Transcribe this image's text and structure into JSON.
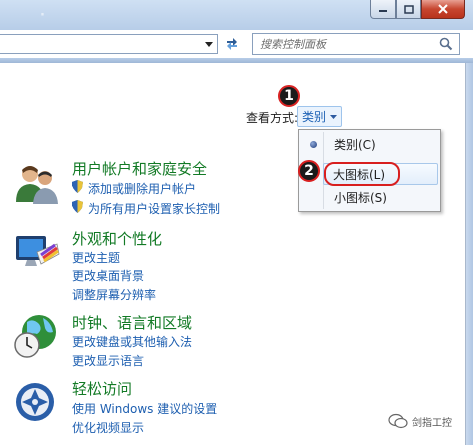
{
  "search": {
    "placeholder": "搜索控制面板"
  },
  "view_by": {
    "label": "查看方式:",
    "current": "类别"
  },
  "view_menu": {
    "items": [
      {
        "label": "类别(C)",
        "selected": true
      },
      {
        "label": "大图标(L)",
        "selected": false
      },
      {
        "label": "小图标(S)",
        "selected": false
      }
    ]
  },
  "annotations": {
    "step1": "1",
    "step2": "2",
    "accent": "#d81f1f"
  },
  "categories": [
    {
      "title": "用户帐户和家庭安全",
      "icon": "users-icon",
      "links": [
        "添加或删除用户帐户",
        "为所有用户设置家长控制"
      ]
    },
    {
      "title": "外观和个性化",
      "icon": "appearance-icon",
      "links": [
        "更改主题",
        "更改桌面背景",
        "调整屏幕分辨率"
      ]
    },
    {
      "title": "时钟、语言和区域",
      "icon": "clock-globe-icon",
      "links": [
        "更改键盘或其他输入法",
        "更改显示语言"
      ]
    },
    {
      "title": "轻松访问",
      "icon": "ease-of-access-icon",
      "links": [
        "使用 Windows 建议的设置",
        "优化视频显示"
      ]
    }
  ],
  "watermark": {
    "text": "剑指工控"
  },
  "colors": {
    "category_title": "#127a25",
    "link": "#1e5fb0"
  }
}
